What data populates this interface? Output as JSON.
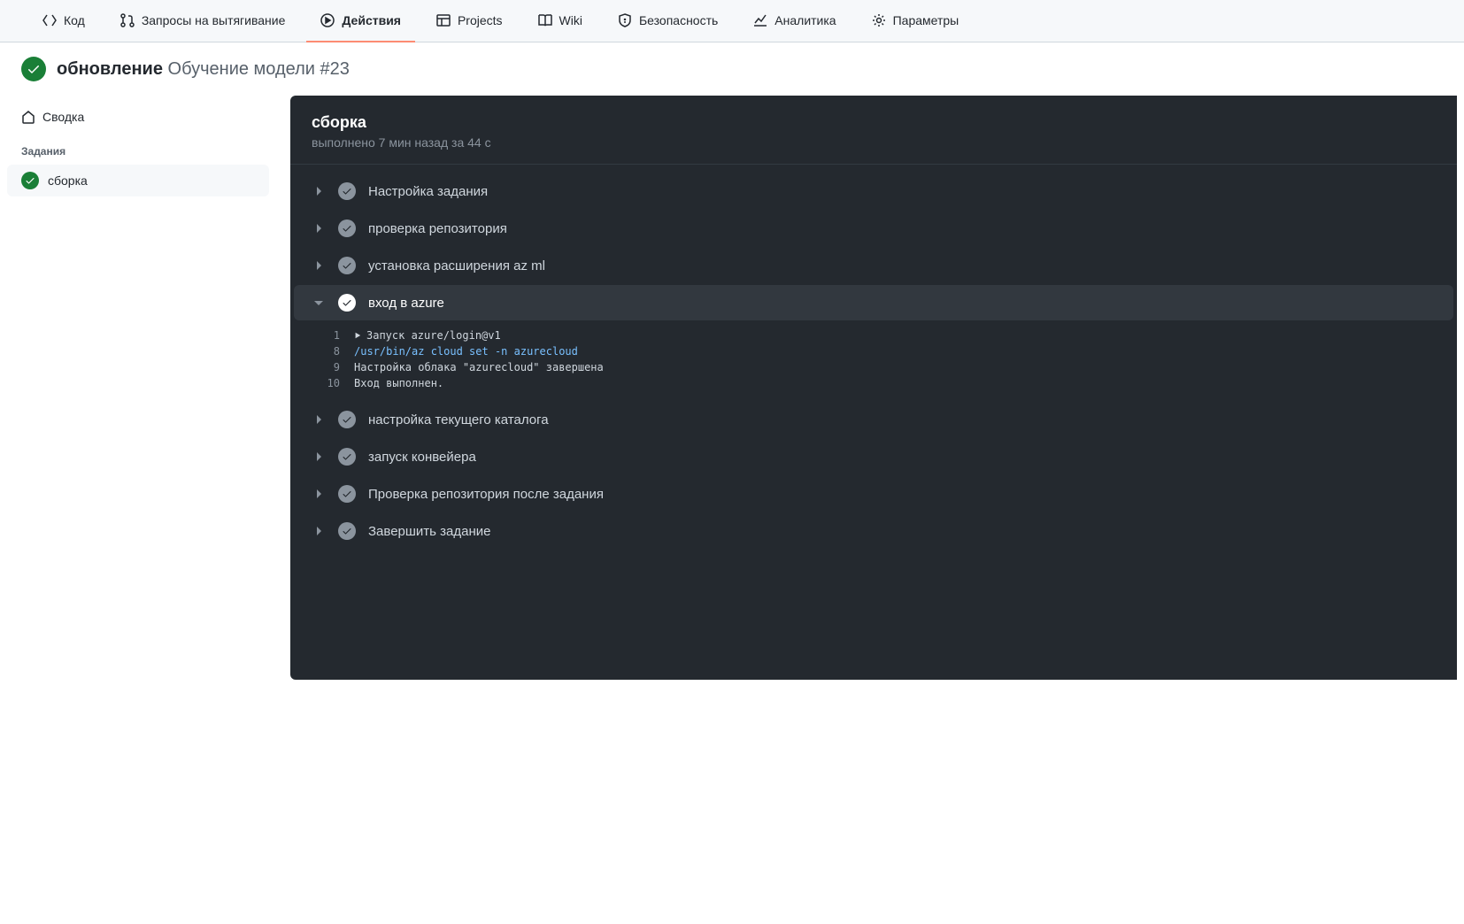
{
  "nav": {
    "code": "Код",
    "pulls": "Запросы на вытягивание",
    "actions": "Действия",
    "projects": "Projects",
    "wiki": "Wiki",
    "security": "Безопасность",
    "insights": "Аналитика",
    "settings": "Параметры"
  },
  "header": {
    "title_bold": "обновление",
    "title_rest": "Обучение модели #23"
  },
  "sidebar": {
    "summary": "Сводка",
    "jobs_heading": "Задания",
    "job_name": "сборка"
  },
  "log": {
    "title": "сборка",
    "subtitle": "выполнено 7 мин назад за 44 с",
    "steps": [
      {
        "label": "Настройка задания",
        "expanded": false
      },
      {
        "label": "проверка репозитория",
        "expanded": false
      },
      {
        "label": "установка расширения az ml",
        "expanded": false
      },
      {
        "label": "вход в azure",
        "expanded": true
      },
      {
        "label": "настройка текущего каталога",
        "expanded": false
      },
      {
        "label": "запуск конвейера",
        "expanded": false
      },
      {
        "label": "Проверка репозитория после задания",
        "expanded": false
      },
      {
        "label": "Завершить задание",
        "expanded": false
      }
    ],
    "lines": [
      {
        "num": "1",
        "text": "Запуск azure/login@v1",
        "toggle": true
      },
      {
        "num": "8",
        "text": "/usr/bin/az cloud set -n azurecloud",
        "command": true
      },
      {
        "num": "9",
        "text": "Настройка облака \"azurecloud\" завершена"
      },
      {
        "num": "10",
        "text": "Вход выполнен."
      }
    ]
  }
}
